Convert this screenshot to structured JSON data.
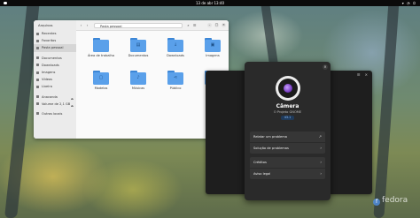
{
  "topbar": {
    "clock": "13 de abr  13:40"
  },
  "files": {
    "title": "Arquivos",
    "path": "Pasta pessoal",
    "sidebar": [
      {
        "label": "Recentes",
        "icon": "clock-icon"
      },
      {
        "label": "Favoritos",
        "icon": "star-icon"
      },
      {
        "label": "Pasta pessoal",
        "icon": "home-icon",
        "active": true
      },
      {
        "label": "Documentos",
        "icon": "document-icon"
      },
      {
        "label": "Downloads",
        "icon": "download-icon"
      },
      {
        "label": "Imagens",
        "icon": "image-icon"
      },
      {
        "label": "Vídeos",
        "icon": "video-icon"
      },
      {
        "label": "Lixeira",
        "icon": "trash-icon"
      },
      {
        "label": "Anaconda",
        "icon": "drive-icon",
        "eject": true
      },
      {
        "label": "Volume de 2,1 GB",
        "icon": "drive-icon",
        "eject": true
      },
      {
        "label": "Outros locais",
        "icon": "plus-icon"
      }
    ],
    "folders": [
      {
        "label": "Área de trabalho",
        "icon": "folder-icon",
        "sym": ""
      },
      {
        "label": "Documentos",
        "icon": "folder-document-icon",
        "sym": "▤"
      },
      {
        "label": "Downloads",
        "icon": "folder-download-icon",
        "sym": "↓"
      },
      {
        "label": "Imagens",
        "icon": "folder-image-icon",
        "sym": "▣"
      },
      {
        "label": "Modelos",
        "icon": "folder-template-icon",
        "sym": "▢"
      },
      {
        "label": "Músicas",
        "icon": "folder-music-icon",
        "sym": "♪"
      },
      {
        "label": "Público",
        "icon": "folder-share-icon",
        "sym": "⋖"
      },
      {
        "label": "Vídeos",
        "icon": "folder-video-icon",
        "sym": "▶"
      }
    ]
  },
  "about": {
    "app_name": "Câmera",
    "developer": "O Projeto GNOME",
    "version": "43.1",
    "group1": [
      "Relatar um problema",
      "Solução de problemas"
    ],
    "group2": [
      "Créditos",
      "Aviso legal"
    ]
  },
  "branding": {
    "text": "fedora"
  }
}
